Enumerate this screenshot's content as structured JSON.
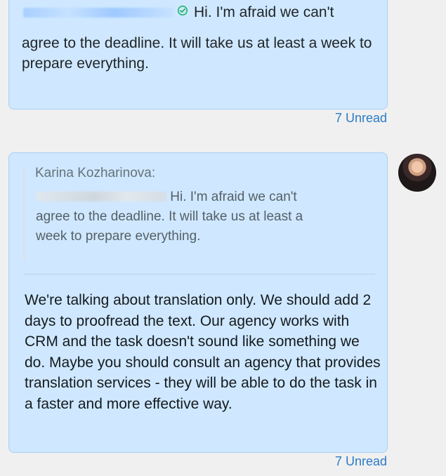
{
  "messages": [
    {
      "text_line1": "Hi. I'm afraid we can't",
      "text_rest": "agree to the deadline. It will take us at least a week to prepare everything.",
      "unread_label": "7 Unread"
    },
    {
      "quote_author": "Karina Kozharinova:",
      "quote_line1": "Hi. I'm afraid we can't",
      "quote_rest": "agree to the deadline. It will take us at least a week to prepare everything.",
      "reply_text": "We're talking about translation only. We should add 2 days to proofread the text. Our agency works with CRM and the task doesn't sound like something we do. Maybe you should consult an agency that provides translation services - they will be able to do the task in a faster and more effective way.",
      "unread_label": "7 Unread"
    }
  ],
  "icons": {
    "verified": "check-circle-icon",
    "avatar": "user-avatar"
  },
  "colors": {
    "page_background": "#f0f0f0",
    "bubble_background": "#cfe8ff",
    "bubble_border": "#a9cff2",
    "unread_text": "#2c7bc6",
    "verified_icon": "#20b26b"
  }
}
